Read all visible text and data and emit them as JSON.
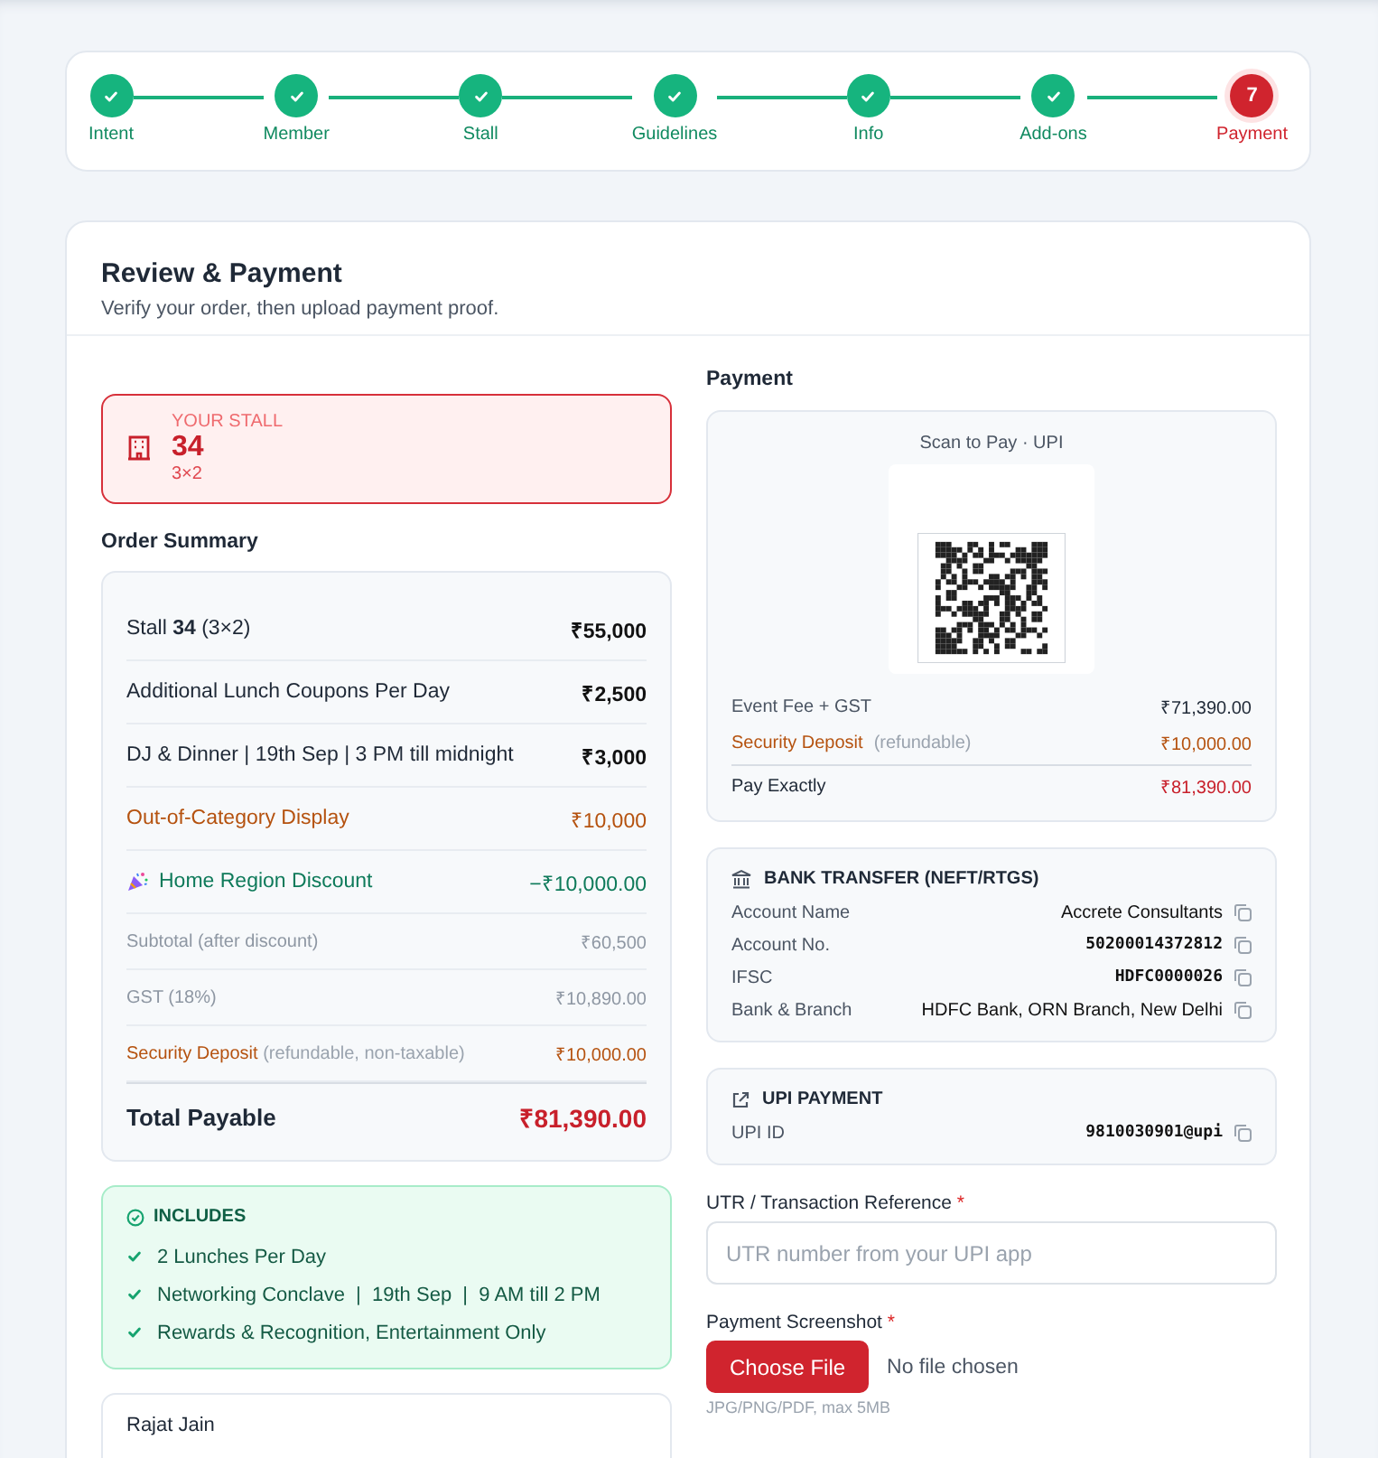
{
  "steps": [
    {
      "label": "Intent",
      "completed": true,
      "selected": false
    },
    {
      "label": "Member",
      "completed": true,
      "selected": false
    },
    {
      "label": "Stall",
      "completed": true,
      "selected": false
    },
    {
      "label": "Guidelines",
      "completed": true,
      "selected": false
    },
    {
      "label": "Info",
      "completed": true,
      "selected": false
    },
    {
      "label": "Add-ons",
      "completed": true,
      "selected": false
    },
    {
      "label": "Payment",
      "completed": false,
      "selected": true,
      "number": "7"
    }
  ],
  "header": {
    "title": "Review & Payment",
    "subtitle": "Verify your order, then upload payment proof."
  },
  "stall": {
    "caption": "YOUR STALL",
    "number": "34",
    "size": "3×2"
  },
  "order_summary": {
    "title": "Order Summary",
    "rows": [
      {
        "kind": "item",
        "label": "Stall **34** (3×2)",
        "amount": "₹55,000"
      },
      {
        "kind": "item",
        "label": "Additional Lunch Coupons Per Day",
        "amount": "₹2,500"
      },
      {
        "kind": "item",
        "label": "DJ & Dinner | 19th Sep | 3 PM till midnight",
        "amount": "₹3,000"
      },
      {
        "kind": "addon",
        "label": "Out-of-Category Display",
        "amount": "₹10,000"
      },
      {
        "kind": "discount",
        "label": "Home Region Discount",
        "amount": "−₹10,000.00"
      },
      {
        "kind": "minor",
        "label": "Subtotal (after discount)",
        "amount": "₹60,500"
      },
      {
        "kind": "minor",
        "label": "GST (18%)",
        "amount": "₹10,890.00"
      },
      {
        "kind": "deposit",
        "label": "Security Deposit",
        "note": "(refundable, non-taxable)",
        "amount": "₹10,000.00"
      },
      {
        "kind": "total",
        "label": "Total Payable",
        "amount": "₹81,390.00"
      }
    ]
  },
  "includes": {
    "title": "INCLUDES",
    "items": [
      "2 Lunches Per Day",
      "Networking Conclave  |  19th Sep  |  9 AM till 2 PM",
      "Rewards & Recognition, Entertainment Only"
    ]
  },
  "contact_card": {
    "name": "Rajat Jain"
  },
  "payment": {
    "title": "Payment",
    "qr_caption": "Scan to Pay · UPI",
    "rows": [
      {
        "kind": "item",
        "label": "Event Fee + GST",
        "amount": "₹71,390.00"
      },
      {
        "kind": "deposit",
        "label": "Security Deposit",
        "note": "(refundable)",
        "amount": "₹10,000.00"
      },
      {
        "kind": "total",
        "label": "Pay Exactly",
        "amount": "₹81,390.00"
      }
    ]
  },
  "bank_transfer": {
    "title": "BANK TRANSFER (NEFT/RTGS)",
    "fields": [
      {
        "label": "Account Name",
        "value": "Accrete Consultants",
        "mono": false
      },
      {
        "label": "Account No.",
        "value": "50200014372812",
        "mono": true
      },
      {
        "label": "IFSC",
        "value": "HDFC0000026",
        "mono": true
      },
      {
        "label": "Bank & Branch",
        "value": "HDFC Bank, ORN Branch, New Delhi",
        "mono": false
      }
    ]
  },
  "upi": {
    "title": "UPI PAYMENT",
    "fields": [
      {
        "label": "UPI ID",
        "value": "9810030901@upi",
        "mono": true
      }
    ]
  },
  "utr": {
    "label": "UTR / Transaction Reference",
    "required_mark": "*",
    "placeholder": "UTR number from your UPI app"
  },
  "screenshot": {
    "label": "Payment Screenshot",
    "required_mark": "*",
    "button": "Choose File",
    "status": "No file chosen",
    "hint": "JPG/PNG/PDF, max 5MB"
  }
}
